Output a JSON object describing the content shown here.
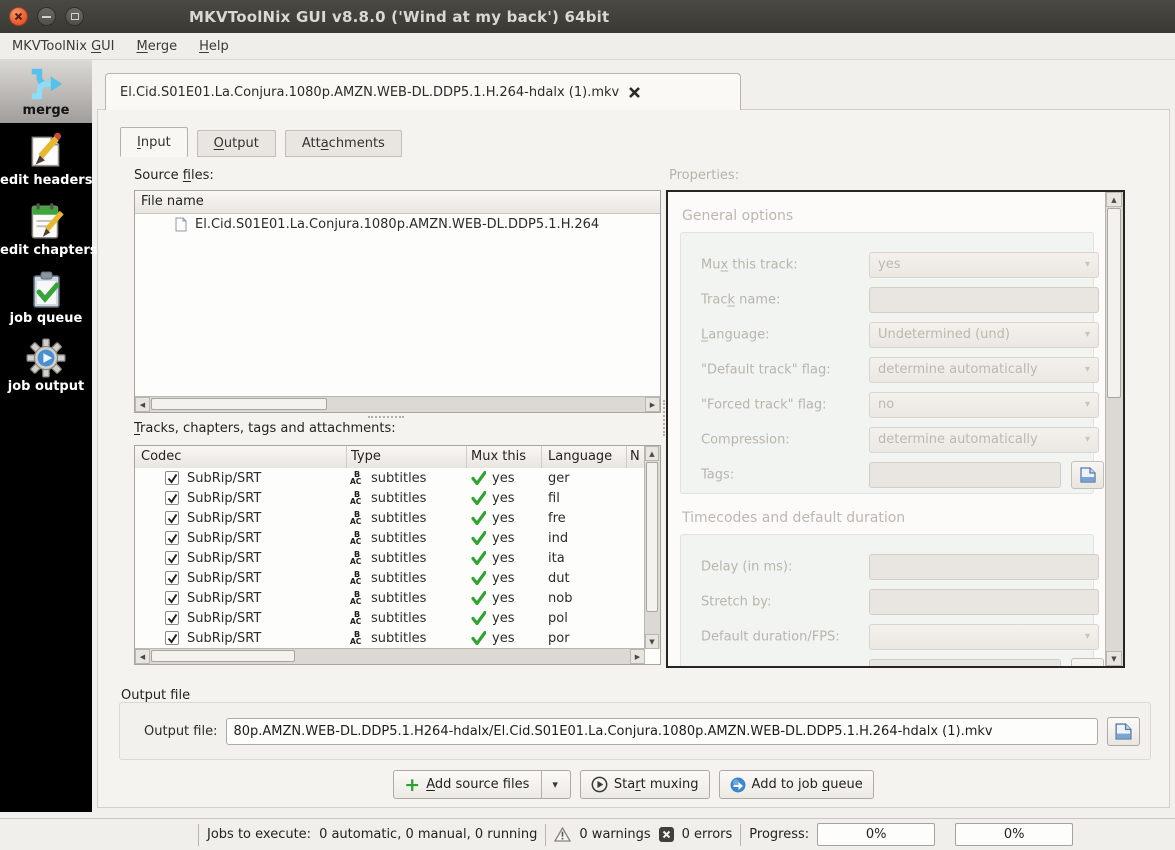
{
  "window": {
    "title": "MKVToolNix GUI v8.8.0 ('Wind at my back') 64bit"
  },
  "menubar": {
    "items": [
      {
        "pre": "MKVToolNix ",
        "key": "G",
        "post": "UI"
      },
      {
        "pre": "",
        "key": "M",
        "post": "erge"
      },
      {
        "pre": "",
        "key": "H",
        "post": "elp"
      }
    ]
  },
  "sidebar": {
    "items": [
      {
        "label": "merge"
      },
      {
        "label": "edit headers"
      },
      {
        "label": "edit chapters"
      },
      {
        "label": "job queue"
      },
      {
        "label": "job output"
      }
    ]
  },
  "tab": {
    "title": "El.Cid.S01E01.La.Conjura.1080p.AMZN.WEB-DL.DDP5.1.H.264-hdalx (1).mkv"
  },
  "subtabs": {
    "input": {
      "pre": "",
      "key": "I",
      "post": "nput"
    },
    "output": {
      "pre": "",
      "key": "O",
      "post": "utput"
    },
    "attachments": {
      "pre": "Att",
      "key": "a",
      "post": "chments"
    }
  },
  "source_files": {
    "label": {
      "pre": "Source ",
      "key": "f",
      "post": "iles:"
    },
    "header": "File name",
    "rows": [
      {
        "name": "El.Cid.S01E01.La.Conjura.1080p.AMZN.WEB-DL.DDP5.1.H.264"
      }
    ]
  },
  "tracks": {
    "label": {
      "pre": "",
      "key": "T",
      "post": "racks, chapters, tags and attachments:"
    },
    "columns": [
      "Codec",
      "Type",
      "Mux this",
      "Language",
      "N"
    ],
    "type_icon": {
      "line1": "B",
      "line2": "AC"
    },
    "rows": [
      {
        "codec": "SubRip/SRT",
        "type": "subtitles",
        "mux": "yes",
        "language": "ger"
      },
      {
        "codec": "SubRip/SRT",
        "type": "subtitles",
        "mux": "yes",
        "language": "fil"
      },
      {
        "codec": "SubRip/SRT",
        "type": "subtitles",
        "mux": "yes",
        "language": "fre"
      },
      {
        "codec": "SubRip/SRT",
        "type": "subtitles",
        "mux": "yes",
        "language": "ind"
      },
      {
        "codec": "SubRip/SRT",
        "type": "subtitles",
        "mux": "yes",
        "language": "ita"
      },
      {
        "codec": "SubRip/SRT",
        "type": "subtitles",
        "mux": "yes",
        "language": "dut"
      },
      {
        "codec": "SubRip/SRT",
        "type": "subtitles",
        "mux": "yes",
        "language": "nob"
      },
      {
        "codec": "SubRip/SRT",
        "type": "subtitles",
        "mux": "yes",
        "language": "pol"
      },
      {
        "codec": "SubRip/SRT",
        "type": "subtitles",
        "mux": "yes",
        "language": "por"
      }
    ]
  },
  "properties": {
    "label": "Properties:",
    "general_title": "General options",
    "mux": {
      "pre": "Mu",
      "key": "x",
      "post": " this track:",
      "value": "yes"
    },
    "track_name": {
      "pre": "Trac",
      "key": "k",
      "post": " name:",
      "value": ""
    },
    "language": {
      "pre": "",
      "key": "L",
      "post": "anguage:",
      "value": "Undetermined (und)"
    },
    "default_flag": {
      "label": "\"Default track\" flag:",
      "value": "determine automatically"
    },
    "forced_flag": {
      "label": "\"Forced track\" flag:",
      "value": "no"
    },
    "compression": {
      "label": "Compression:",
      "value": "determine automatically"
    },
    "tags": {
      "label": "Tags:",
      "value": ""
    },
    "timecodes_title": "Timecodes and default duration",
    "delay": {
      "label": "Delay (in ms):",
      "value": ""
    },
    "stretch": {
      "label": "Stretch by:",
      "value": ""
    },
    "default_duration": {
      "label": "Default duration/FPS:",
      "value": ""
    }
  },
  "output_file": {
    "group_title": "Output file",
    "label": "Output file:",
    "value": "80p.AMZN.WEB-DL.DDP5.1.H264-hdalx/El.Cid.S01E01.La.Conjura.1080p.AMZN.WEB-DL.DDP5.1.H.264-hdalx (1).mkv"
  },
  "actions": {
    "add_source_files": {
      "pre": "",
      "key": "A",
      "post": "dd source files"
    },
    "start_muxing": {
      "pre": "Sta",
      "key": "r",
      "post": "t muxing"
    },
    "add_to_job_queue": {
      "pre": "Add to job ",
      "key": "q",
      "post": "ueue"
    }
  },
  "statusbar": {
    "jobs_label": "Jobs to execute:",
    "jobs_value": "0 automatic, 0 manual, 0 running",
    "warnings": "0 warnings",
    "errors": "0 errors",
    "progress_label": "Progress:",
    "progress1": "0%",
    "progress2": "0%"
  },
  "icons": {
    "scroll_up": "▲",
    "scroll_down": "▼",
    "scroll_left": "◀",
    "scroll_right": "▶",
    "dropdown": "▾"
  },
  "colors": {
    "titlebar": "#3c3b37",
    "close_button": "#e4572e",
    "sidebar_bg": "#000000",
    "accent_green": "#35a135",
    "disabled_text": "#b9b5ad",
    "panel_border": "#26251f"
  }
}
